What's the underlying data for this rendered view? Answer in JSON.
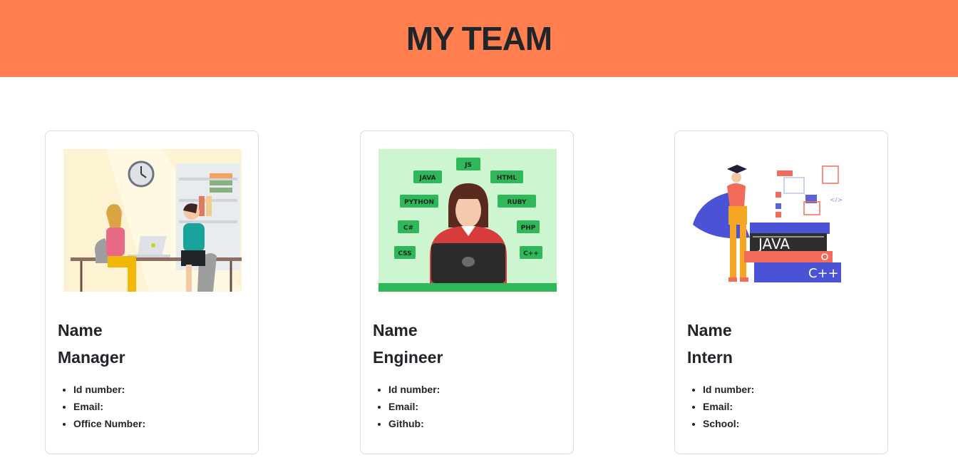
{
  "header": {
    "title": "MY TEAM"
  },
  "cards": [
    {
      "name": "Name",
      "role": "Manager",
      "fields": [
        "Id number:",
        "Email:",
        "Office Number:"
      ]
    },
    {
      "name": "Name",
      "role": "Engineer",
      "fields": [
        "Id number:",
        "Email:",
        "Github:"
      ],
      "image_tags": [
        "JS",
        "JAVA",
        "HTML",
        "PYTHON",
        "RUBY",
        "C#",
        "PHP",
        "CSS",
        "C++"
      ]
    },
    {
      "name": "Name",
      "role": "Intern",
      "fields": [
        "Id number:",
        "Email:",
        "School:"
      ],
      "image_books": [
        "JAVA",
        "C++"
      ]
    }
  ],
  "colors": {
    "header_bg": "#ff7f50",
    "text": "#212529",
    "card_border": "#dcdcdc"
  }
}
